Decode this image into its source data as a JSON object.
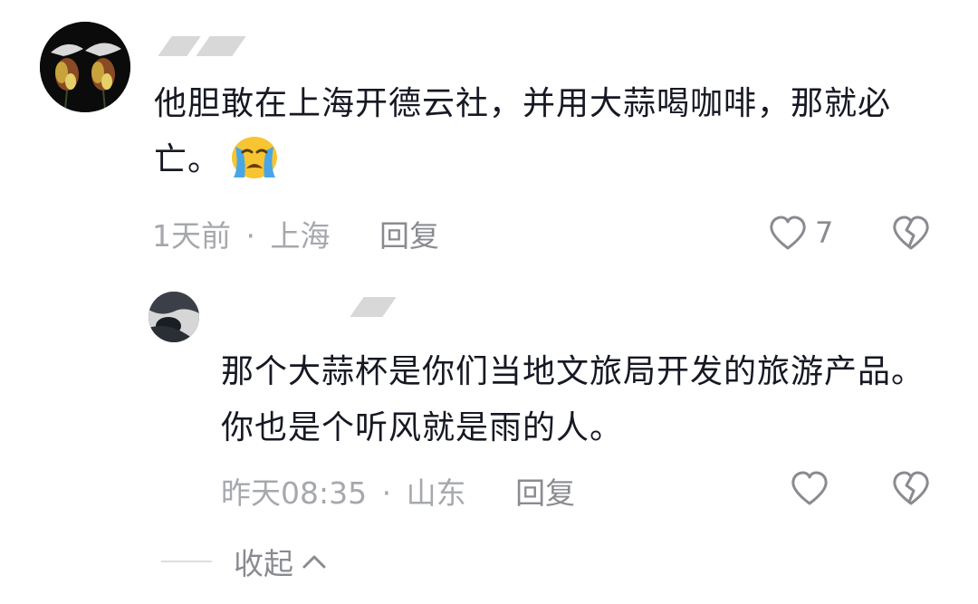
{
  "comment": {
    "username": "",
    "text": "他胆敢在上海开德云社，并用大蒜喝咖啡，那就必亡。",
    "emoji": "loudly-crying-face-emoji",
    "time": "1天前",
    "location": "上海",
    "meta_separator": "·",
    "reply_label": "回复",
    "like_count": "7"
  },
  "reply": {
    "username": "",
    "text": "那个大蒜杯是你们当地文旅局开发的旅游产品。你也是个听风就是雨的人。",
    "time": "昨天08:35",
    "location": "山东",
    "meta_separator": "·",
    "reply_label": "回复"
  },
  "collapse": {
    "label": "收起"
  },
  "colors": {
    "text": "#161823",
    "meta": "#a6a8ad",
    "action": "#8a8b91"
  }
}
